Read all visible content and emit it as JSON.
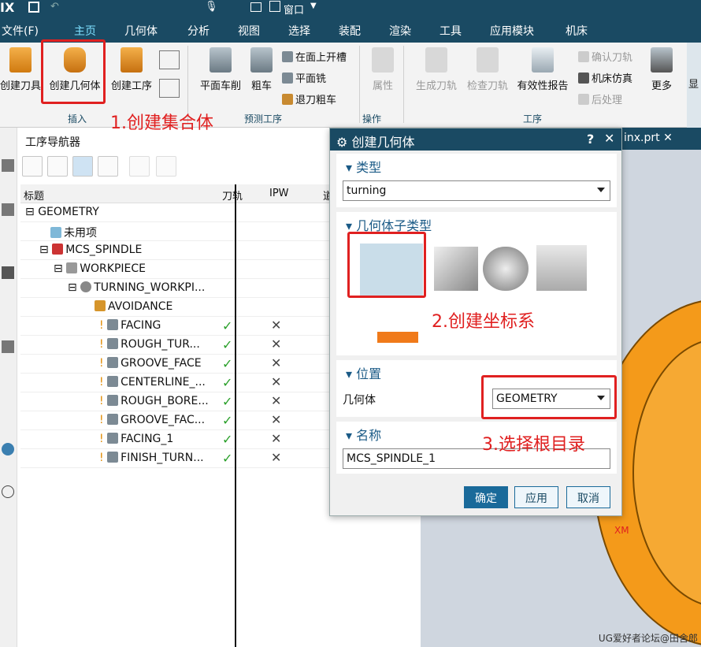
{
  "app": {
    "logo": "IX",
    "quick_access_window": "窗口"
  },
  "menubar": [
    "文件(F)",
    "主页",
    "几何体",
    "分析",
    "视图",
    "选择",
    "装配",
    "渲染",
    "工具",
    "应用模块",
    "机床"
  ],
  "ribbon": {
    "insert": {
      "create_tool": "创建刀具",
      "create_geometry": "创建几何体",
      "create_operation": "创建工序",
      "group_label": "插入"
    },
    "predict": {
      "face_lathe": "平面车削",
      "rough_turn": "粗车",
      "face_groove": "在面上开槽",
      "face_mill": "平面铣",
      "retract_rough": "退刀粗车",
      "group_label": "预测工序"
    },
    "operation": {
      "properties": "属性",
      "group_label": "操作"
    },
    "process": {
      "generate": "生成刀轨",
      "verify": "检查刀轨",
      "validity_report": "有效性报告",
      "confirm_tool": "确认刀轨",
      "machine_sim": "机床仿真",
      "post": "后处理",
      "more": "更多",
      "group_label": "工序"
    },
    "show": "显"
  },
  "navigator": {
    "title": "工序导航器",
    "columns": [
      "标题",
      "刀轨",
      "IPW",
      "道"
    ],
    "rows": [
      {
        "name": "GEOMETRY",
        "path": null,
        "ipw": null
      },
      {
        "name": "未用项",
        "path": null,
        "ipw": null
      },
      {
        "name": "MCS_SPINDLE",
        "path": null,
        "ipw": null
      },
      {
        "name": "WORKPIECE",
        "path": null,
        "ipw": null
      },
      {
        "name": "TURNING_WORKPI...",
        "path": null,
        "ipw": null
      },
      {
        "name": "AVOIDANCE",
        "path": null,
        "ipw": null
      },
      {
        "name": "FACING",
        "path": "✓",
        "ipw": "✕"
      },
      {
        "name": "ROUGH_TUR...",
        "path": "✓",
        "ipw": "✕"
      },
      {
        "name": "GROOVE_FACE",
        "path": "✓",
        "ipw": "✕"
      },
      {
        "name": "CENTERLINE_...",
        "path": "✓",
        "ipw": "✕"
      },
      {
        "name": "ROUGH_BORE...",
        "path": "✓",
        "ipw": "✕"
      },
      {
        "name": "GROOVE_FAC...",
        "path": "✓",
        "ipw": "✕"
      },
      {
        "name": "FACING_1",
        "path": "✓",
        "ipw": "✕"
      },
      {
        "name": "FINISH_TURN...",
        "path": "✓",
        "ipw": "✕"
      }
    ]
  },
  "viewport": {
    "tab": "inx.prt",
    "axis_label": "XM"
  },
  "dialog": {
    "title": "创建几何体",
    "help": "?",
    "type": {
      "label": "类型",
      "value": "turning"
    },
    "subtype": {
      "label": "几何体子类型"
    },
    "location": {
      "label": "位置",
      "geometry_label": "几何体",
      "geometry_value": "GEOMETRY"
    },
    "name": {
      "label": "名称",
      "value": "MCS_SPINDLE_1"
    },
    "buttons": {
      "ok": "确定",
      "apply": "应用",
      "cancel": "取消"
    }
  },
  "annotations": {
    "a1": "1.创建集合体",
    "a2": "2.创建坐标系",
    "a3": "3.选择根目录"
  },
  "watermark": "UG爱好者论坛@田舍郎",
  "colors": {
    "accent": "#1a4a63",
    "highlight": "#e02020",
    "ok": "#2aa02a",
    "part": "#f49a1a"
  }
}
